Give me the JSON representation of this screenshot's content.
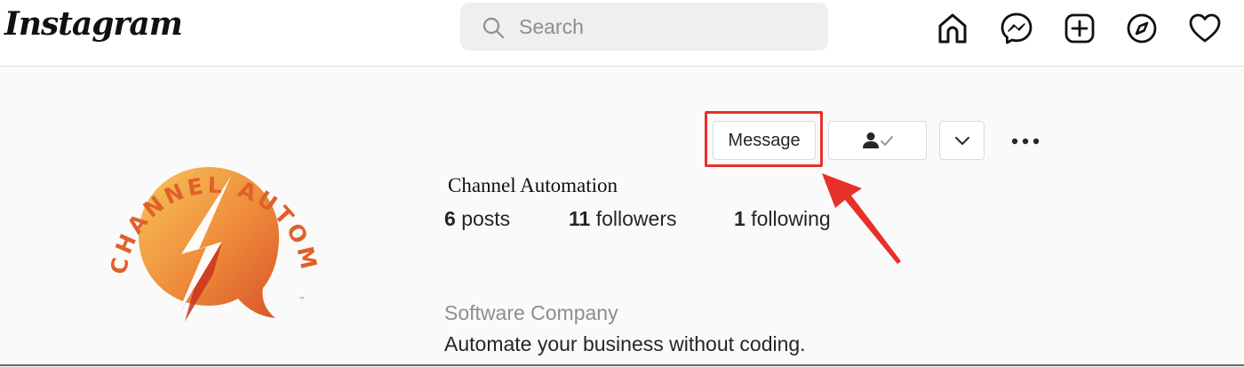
{
  "app": {
    "logo_text": "Instagram"
  },
  "search": {
    "placeholder": "Search",
    "value": ""
  },
  "nav_icons": [
    "home-icon",
    "messenger-icon",
    "new-post-icon",
    "explore-icon",
    "activity-heart-icon"
  ],
  "profile": {
    "avatar_brand_text": "CHANNEL AUTOMATION",
    "username": "Channel Automation",
    "buttons": {
      "message_label": "Message"
    },
    "stats": {
      "posts_count": "6",
      "posts_label": "posts",
      "followers_count": "11",
      "followers_label": "followers",
      "following_count": "1",
      "following_label": "following"
    },
    "category": "Software Company",
    "bio": "Automate your business without coding."
  },
  "colors": {
    "highlight": "#e8302a",
    "logo_orange": "#e0602a",
    "logo_yellow": "#f3b13c",
    "logo_red": "#c7341e"
  }
}
